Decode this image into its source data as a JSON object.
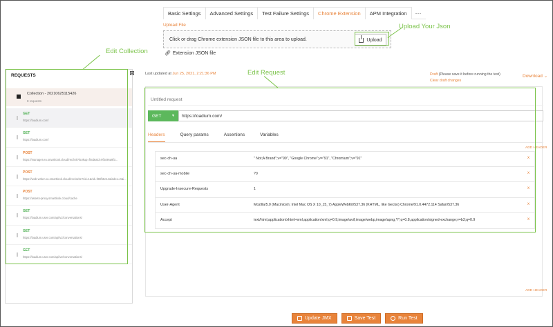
{
  "top_tabs": [
    {
      "label": "Basic Settings",
      "active": false
    },
    {
      "label": "Advanced Settings",
      "active": false
    },
    {
      "label": "Test Failure Settings",
      "active": false
    },
    {
      "label": "Chrome Extension",
      "active": true
    },
    {
      "label": "APM Integration",
      "active": false
    }
  ],
  "tab_more": "···",
  "upload": {
    "title": "Upload File",
    "hint": "Click or drag Chrome extension JSON file to this area to upload.",
    "button_label": "Upload",
    "file_name": "Extension JSON file"
  },
  "annotations": {
    "upload_json": "Upload Your Json",
    "edit_collection": "Edit Collection",
    "edit_request": "Edit Request"
  },
  "left_panel": {
    "title": "REQUESTS",
    "collection_name": "Collection - 20210625115426",
    "collection_count": "8 requests",
    "requests": [
      {
        "method": "GET",
        "url": "https://loadium.com/"
      },
      {
        "method": "GET",
        "url": "https://loadium.com/"
      },
      {
        "method": "POST",
        "url": "https://manager.eu.smartlook.cloud/rec/init?lookup=find&sid=9f3c96a9f3..."
      },
      {
        "method": "POST",
        "url": "https://web-writer.eu.smartlook.cloud/rec/write?rid=1&rid=f36fb5c14&index=0&i..."
      },
      {
        "method": "POST",
        "url": "https://assets-proxy.smartlook.cloud/cache"
      },
      {
        "method": "GET",
        "url": "https://loadium.user.com/api/v2/conversations/"
      },
      {
        "method": "GET",
        "url": "https://loadium.user.com/api/v2/conversations/"
      },
      {
        "method": "GET",
        "url": "https://loadium.user.com/api/v2/conversations/"
      }
    ]
  },
  "last_updated_label": "Last updated at",
  "last_updated_value": "Jun 25, 2021, 2:21:36 PM",
  "draft_label": "Draft",
  "draft_note": "(Please save it before running the test)",
  "clear_draft": "Clear draft changes",
  "download": "Download ⌄",
  "request": {
    "name_placeholder": "Untitled request",
    "method": "GET",
    "url": "https://loadium.com/"
  },
  "sub_tabs": [
    {
      "label": "Headers",
      "active": true
    },
    {
      "label": "Query params",
      "active": false
    },
    {
      "label": "Assertions",
      "active": false
    },
    {
      "label": "Variables",
      "active": false
    }
  ],
  "add_header": "ADD HEADER",
  "headers": [
    {
      "key": "sec-ch-ua",
      "value": "\" Not;A Brand\";v=\"99\", \"Google Chrome\";v=\"91\", \"Chromium\";v=\"91\""
    },
    {
      "key": "sec-ch-ua-mobile",
      "value": "?0"
    },
    {
      "key": "Upgrade-Insecure-Requests",
      "value": "1"
    },
    {
      "key": "User-Agent",
      "value": "Mozilla/5.0 (Macintosh; Intel Mac OS X 10_15_7) AppleWebKit/537.36 (KHTML, like Gecko) Chrome/91.0.4472.114 Safari/537.36"
    },
    {
      "key": "Accept",
      "value": "text/html,application/xhtml+xml,application/xml;q=0.9,image/avif,image/webp,image/apng,*/*;q=0.8,application/signed-exchange;v=b3;q=0.9"
    }
  ],
  "delete_glyph": "x",
  "actions": {
    "update_jmx": "Update JMX",
    "save_test": "Save Test",
    "run_test": "Run Test"
  },
  "colors": {
    "accent": "#e8833a",
    "get": "#4caf50",
    "annotation": "#7bc34a"
  }
}
